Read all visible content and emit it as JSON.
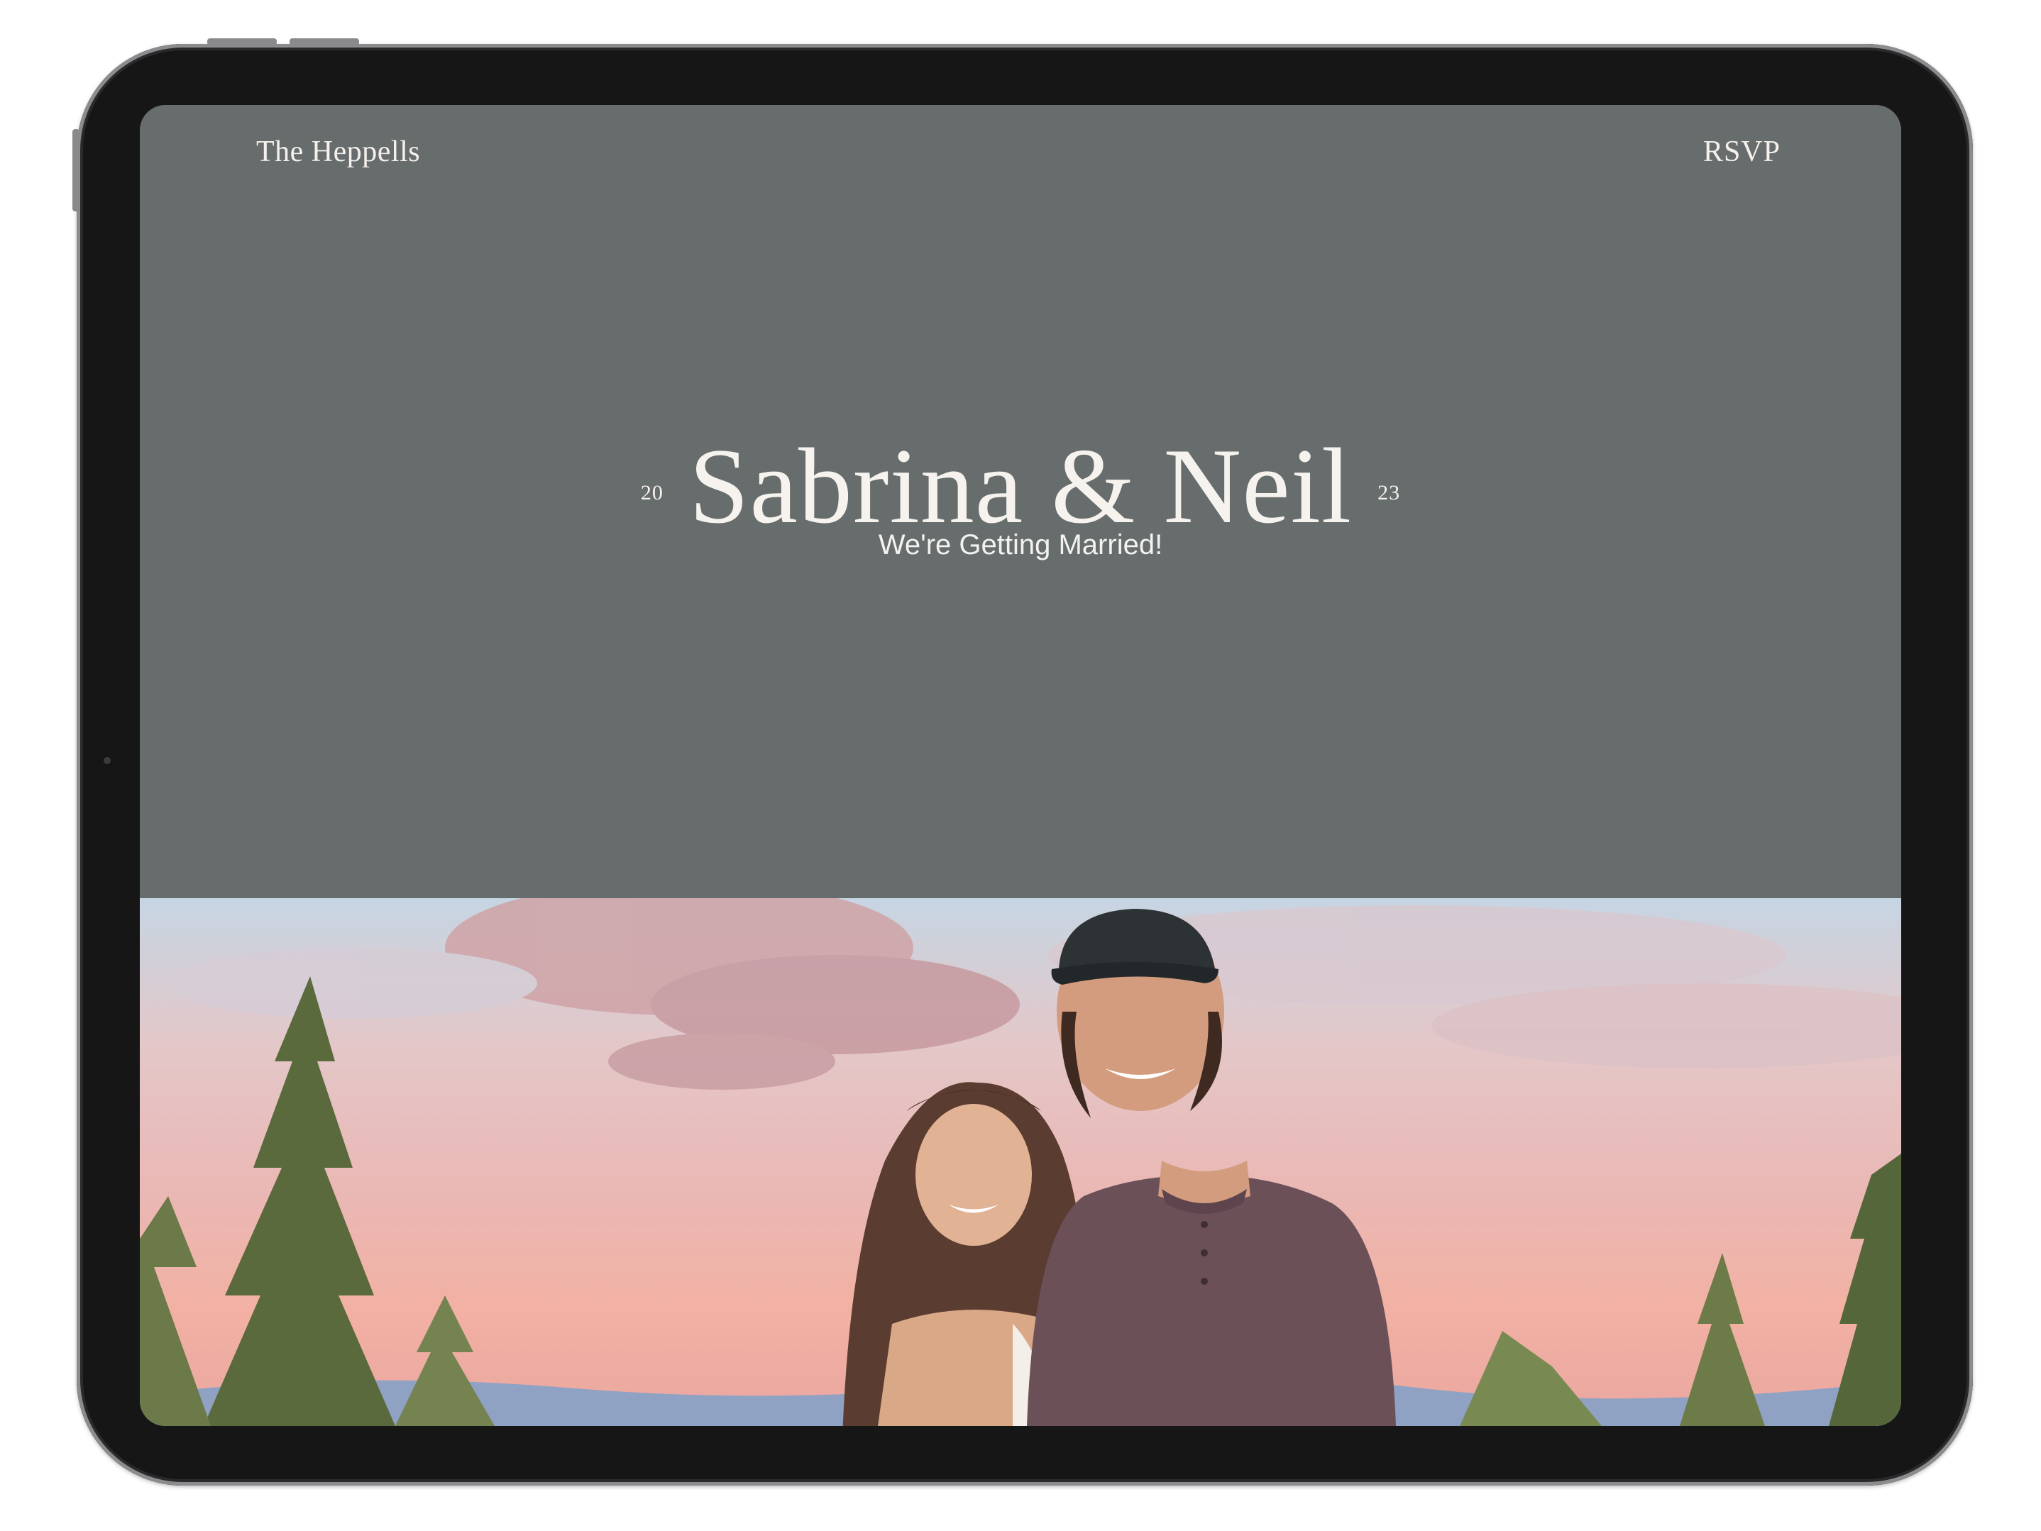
{
  "nav": {
    "brand": "The Heppells",
    "rsvp": "RSVP"
  },
  "hero": {
    "year_left": "20",
    "names": "Sabrina & Neil",
    "year_right": "23",
    "tagline": "We're Getting Married!"
  },
  "photo": {
    "description_icon": "couple-photo"
  },
  "colors": {
    "hero_background": "#676c6c",
    "text": "#f4f1ec",
    "device_frame": "#161616"
  }
}
